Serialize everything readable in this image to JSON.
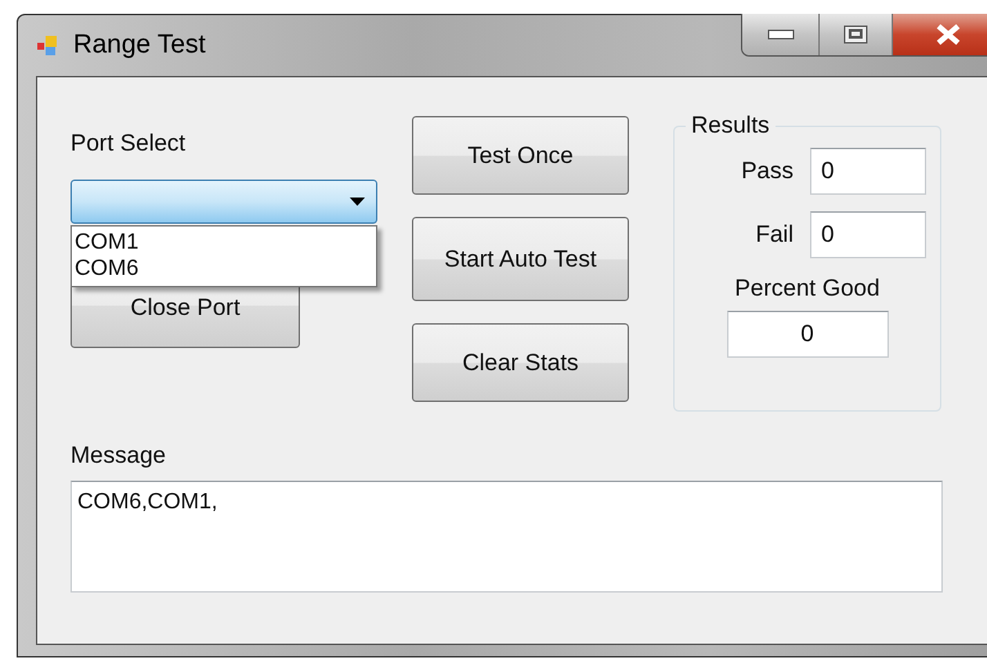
{
  "window": {
    "title": "Range Test"
  },
  "port_select": {
    "label": "Port Select",
    "expanded": true,
    "options": [
      "COM1",
      "COM6"
    ]
  },
  "port_button": {
    "label": "Close Port"
  },
  "test_buttons": [
    {
      "label": "Test Once"
    },
    {
      "label": "Start Auto Test"
    },
    {
      "label": "Clear Stats"
    }
  ],
  "results": {
    "title": "Results",
    "fields": [
      {
        "label": "Pass",
        "value": "0"
      },
      {
        "label": "Fail",
        "value": "0"
      }
    ],
    "percent_good": {
      "label": "Percent Good",
      "value": "0"
    }
  },
  "message": {
    "label": "Message",
    "value": "COM6,COM1,"
  }
}
